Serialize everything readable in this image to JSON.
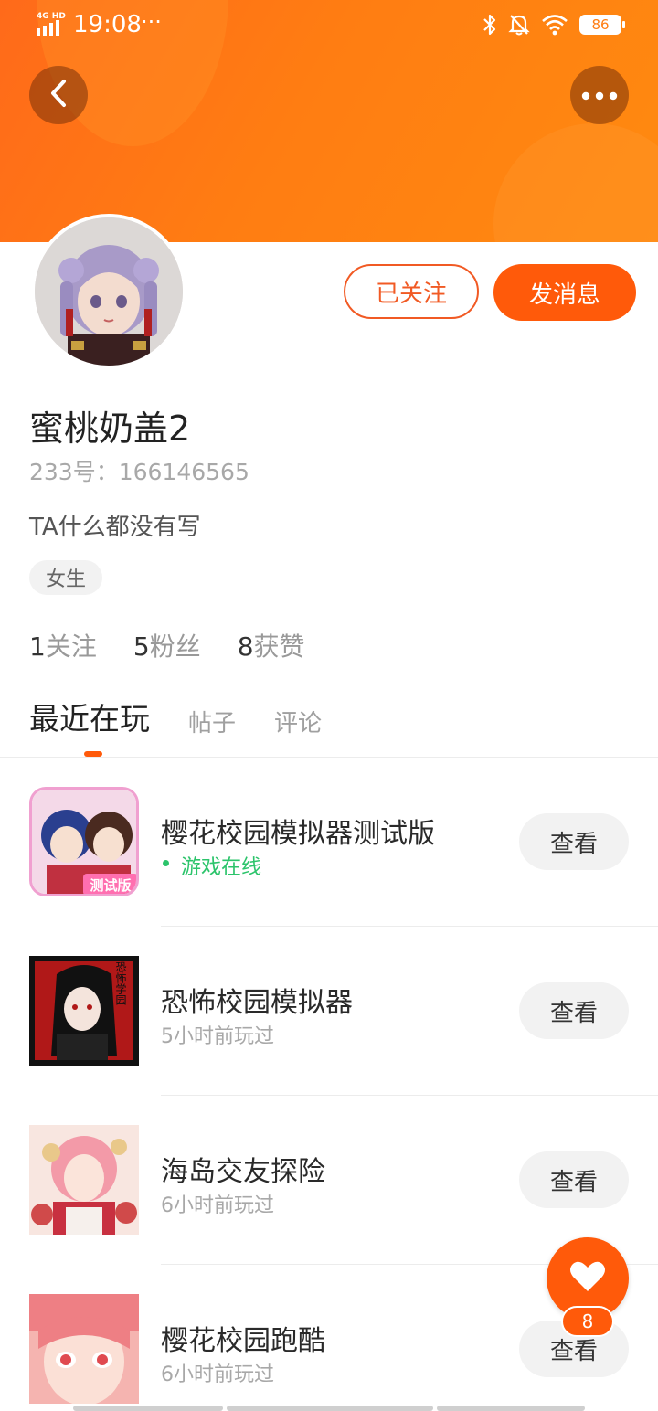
{
  "status_bar": {
    "network": "4G HD",
    "time": "19:08",
    "dots": "···",
    "battery": "86"
  },
  "profile": {
    "name": "蜜桃奶盖2",
    "uid_label": "233号：",
    "uid": "166146565",
    "bio": "TA什么都没有写",
    "gender_tag": "女生"
  },
  "actions": {
    "follow_label": "已关注",
    "message_label": "发消息"
  },
  "stats": [
    {
      "num": "1",
      "label": "关注"
    },
    {
      "num": "5",
      "label": "粉丝"
    },
    {
      "num": "8",
      "label": "获赞"
    }
  ],
  "tabs": [
    {
      "label": "最近在玩",
      "active": true
    },
    {
      "label": "帖子",
      "active": false
    },
    {
      "label": "评论",
      "active": false
    }
  ],
  "games": [
    {
      "title": "樱花校园模拟器测试版",
      "sub": "游戏在线",
      "online": true,
      "icon_text": "测试版",
      "view_label": "查看"
    },
    {
      "title": "恐怖校园模拟器",
      "sub": "5小时前玩过",
      "online": false,
      "icon_text": "恐怖学园",
      "view_label": "查看"
    },
    {
      "title": "海岛交友探险",
      "sub": "6小时前玩过",
      "online": false,
      "icon_text": "",
      "view_label": "查看"
    },
    {
      "title": "樱花校园跑酷",
      "sub": "6小时前玩过",
      "online": false,
      "icon_text": "",
      "view_label": "查看"
    }
  ],
  "like": {
    "count": "8"
  },
  "colors": {
    "brand": "#ff5a0a",
    "banner": "#ff7d12",
    "online": "#2cc46b"
  },
  "icons": [
    "back-icon",
    "more-icon",
    "bluetooth-icon",
    "mute-bell-icon",
    "wifi-icon",
    "heart-icon"
  ]
}
